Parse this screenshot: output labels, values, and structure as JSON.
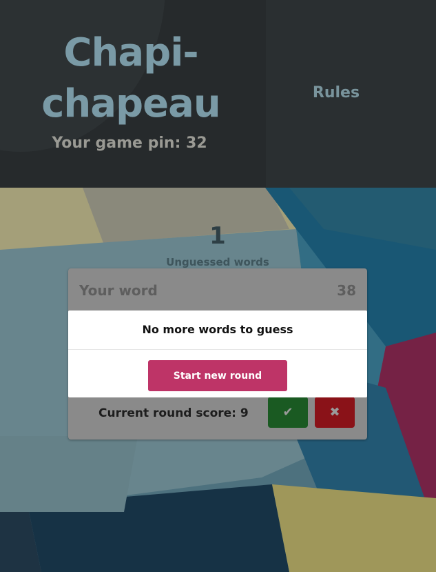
{
  "app": {
    "title": "Chapi-chapeau",
    "title_line1": "Chapi-",
    "title_line2": "chapeau",
    "game_pin": "Your game pin: 32",
    "rules_link": "Rules"
  },
  "game": {
    "unguessed_count": "1",
    "unguessed_label": "Unguessed words",
    "word_label": "Your word",
    "timer": "38",
    "score_text": "Current round score: 9",
    "accept_icon": "check-icon",
    "reject_icon": "cross-icon"
  },
  "modal": {
    "message": "No more words to guess",
    "start_button": "Start new round"
  },
  "colors": {
    "accent": "#be3467",
    "accept": "#1a5a22",
    "reject": "#8a1218",
    "title": "#7a9aa6"
  }
}
